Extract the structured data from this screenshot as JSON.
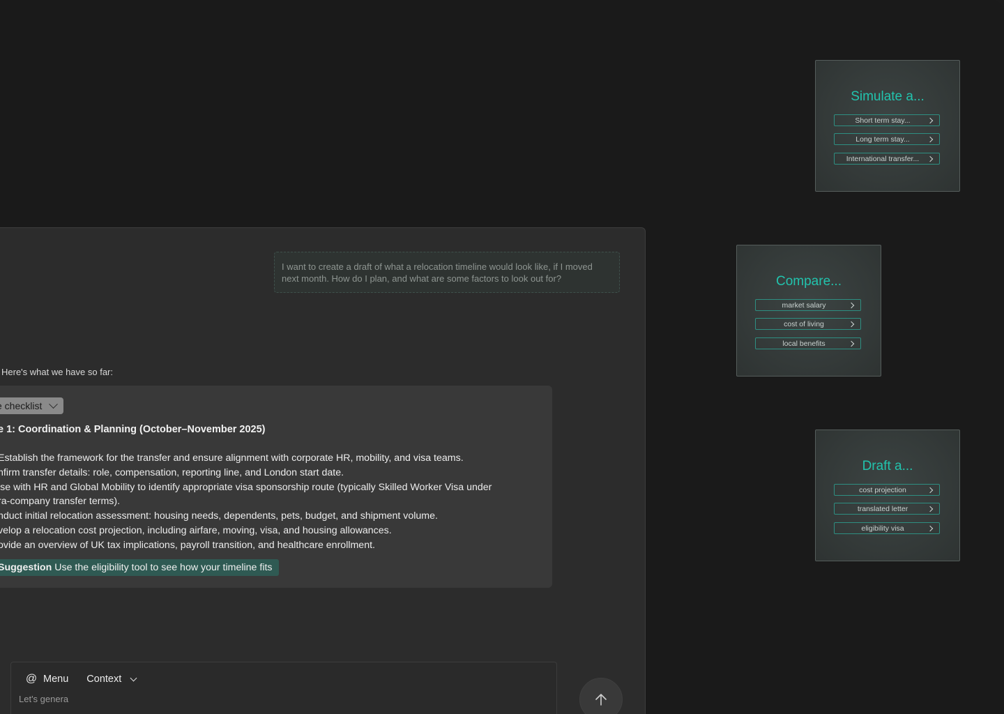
{
  "chat": {
    "user_message": "I want to create a draft of what a relocation timeline would look like, if I moved next month. How do I plan, and what are some factors to look out for?",
    "intro_text": "Here's what we have so far:",
    "checklist_label": "e checklist",
    "phase_title": "e 1: Coordination & Planning (October–November 2025)",
    "lines": [
      "Establish the framework for the transfer and ensure alignment with corporate HR, mobility, and visa teams.",
      "nfirm transfer details: role, compensation, reporting line, and London start date.",
      "ise with HR and Global Mobility to identify appropriate visa sponsorship route (typically Skilled Worker Visa under",
      "ra-company transfer terms).",
      "nduct initial relocation assessment: housing needs, dependents, pets, budget, and shipment volume.",
      "velop a relocation cost projection, including airfare, moving, visa, and housing allowances.",
      "ovide an overview of UK tax implications, payroll transition, and healthcare enrollment."
    ],
    "suggestion_label": "Suggestion",
    "suggestion_text": "Use the eligibility tool to see how your timeline fits"
  },
  "composer": {
    "menu_label": "Menu",
    "context_label": "Context",
    "input_value": "Let's genera"
  },
  "cards": {
    "simulate": {
      "title": "Simulate a...",
      "options": [
        "Short term stay...",
        "Long term stay...",
        "International transfer..."
      ]
    },
    "compare": {
      "title": "Compare...",
      "options": [
        "market salary",
        "cost of living",
        "local benefits"
      ]
    },
    "draft": {
      "title": "Draft a...",
      "options": [
        "cost projection",
        "translated letter",
        "eligibility visa"
      ]
    }
  },
  "colors": {
    "accent": "#22c3ad",
    "suggestion_bg": "#2f5a53",
    "background": "#1a1a1a"
  }
}
